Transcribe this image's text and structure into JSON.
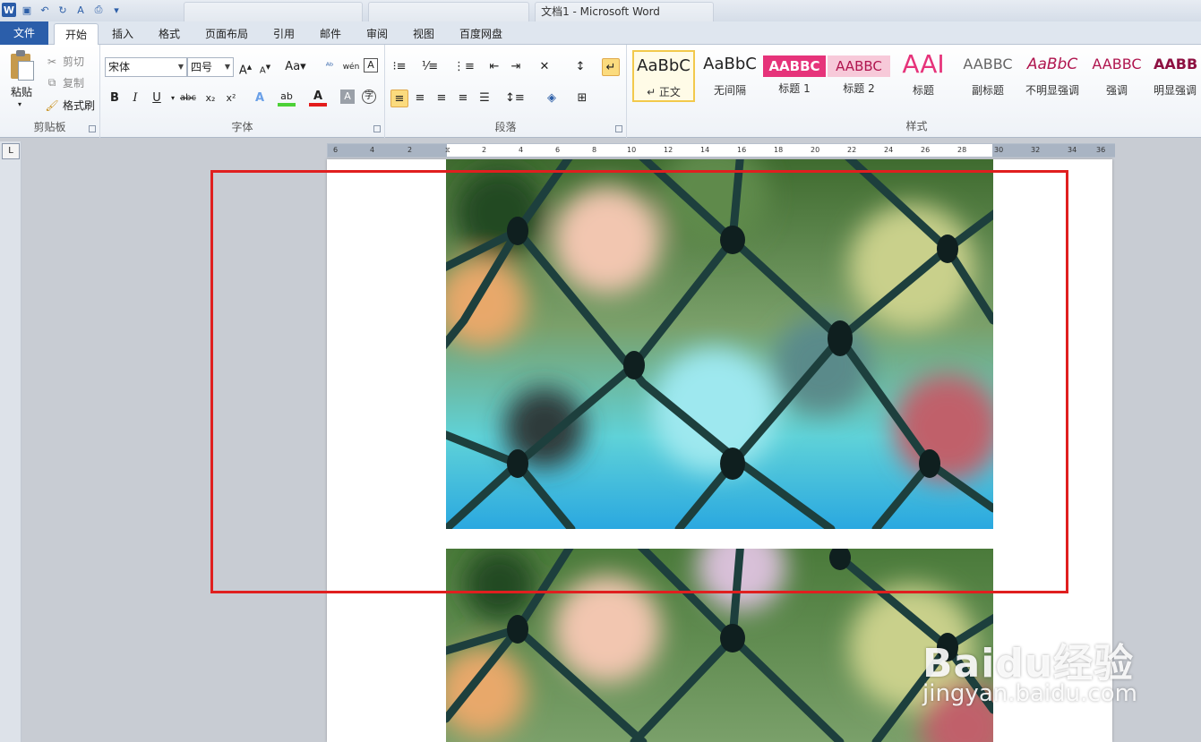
{
  "window": {
    "title": "文档1 - Microsoft Word"
  },
  "tabs": [
    "文件",
    "开始",
    "插入",
    "格式",
    "页面布局",
    "引用",
    "邮件",
    "审阅",
    "视图",
    "百度网盘"
  ],
  "active_tab": "开始",
  "clipboard": {
    "paste": "粘贴",
    "cut": "剪切",
    "copy": "复制",
    "format_painter": "格式刷",
    "group_label": "剪贴板"
  },
  "font": {
    "name": "宋体",
    "size": "四号",
    "group_label": "字体"
  },
  "paragraph": {
    "group_label": "段落"
  },
  "styles": {
    "group_label": "样式",
    "items": [
      {
        "sample": "AaBbC",
        "name": "↵ 正文"
      },
      {
        "sample": "AaBbC",
        "name": "无间隔"
      },
      {
        "sample": "AABBC",
        "name": "标题 1"
      },
      {
        "sample": "AABBC",
        "name": "标题 2"
      },
      {
        "sample": "AAI",
        "name": "标题"
      },
      {
        "sample": "AABBC",
        "name": "副标题"
      },
      {
        "sample": "AaBbC",
        "name": "不明显强调"
      },
      {
        "sample": "AABBC",
        "name": "强调"
      },
      {
        "sample": "AABB",
        "name": "明显强调"
      }
    ]
  },
  "ruler": {
    "ticks": [
      "6",
      "4",
      "2",
      "",
      "2",
      "4",
      "6",
      "8",
      "10",
      "12",
      "14",
      "16",
      "18",
      "20",
      "22",
      "24",
      "26",
      "28",
      "30",
      "32",
      "34",
      "36",
      "38"
    ]
  },
  "watermark": {
    "brand": "Baidu经验",
    "url": "jingyan.baidu.com"
  },
  "colors": {
    "file_tab": "#2b5eaa",
    "highlight": "#e01f1f",
    "fence": "#1d3f3d"
  }
}
